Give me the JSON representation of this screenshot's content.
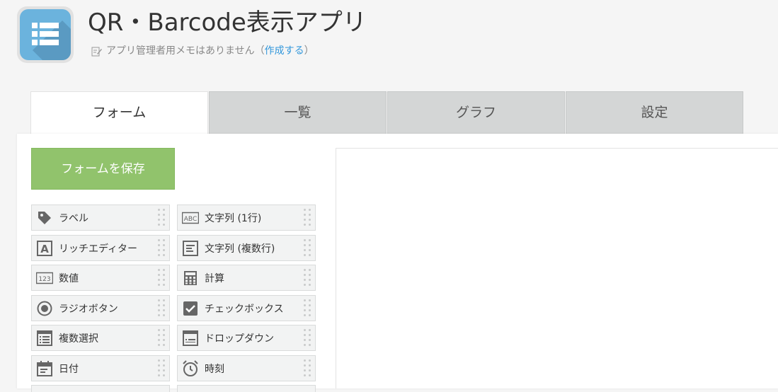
{
  "app": {
    "title": "QR・Barcode表示アプリ",
    "icon": "list-app-icon",
    "memo_text": "アプリ管理者用メモはありません（",
    "memo_link": "作成する",
    "memo_close": "）"
  },
  "tabs": [
    {
      "label": "フォーム",
      "active": true
    },
    {
      "label": "一覧",
      "active": false
    },
    {
      "label": "グラフ",
      "active": false
    },
    {
      "label": "設定",
      "active": false
    }
  ],
  "save_button": "フォームを保存",
  "fields": [
    {
      "label": "ラベル",
      "icon": "tag-icon"
    },
    {
      "label": "文字列 (1行)",
      "icon": "abc-icon"
    },
    {
      "label": "リッチエディター",
      "icon": "rich-text-icon"
    },
    {
      "label": "文字列 (複数行)",
      "icon": "multiline-text-icon"
    },
    {
      "label": "数値",
      "icon": "number-123-icon"
    },
    {
      "label": "計算",
      "icon": "calculator-icon"
    },
    {
      "label": "ラジオボタン",
      "icon": "radio-icon"
    },
    {
      "label": "チェックボックス",
      "icon": "checkbox-icon"
    },
    {
      "label": "複数選択",
      "icon": "multi-select-icon"
    },
    {
      "label": "ドロップダウン",
      "icon": "dropdown-icon"
    },
    {
      "label": "日付",
      "icon": "calendar-icon"
    },
    {
      "label": "時刻",
      "icon": "clock-icon"
    }
  ],
  "colors": {
    "save_green": "#91c36c",
    "link_blue": "#3498db",
    "app_icon_blue": "#6bb3dd"
  }
}
